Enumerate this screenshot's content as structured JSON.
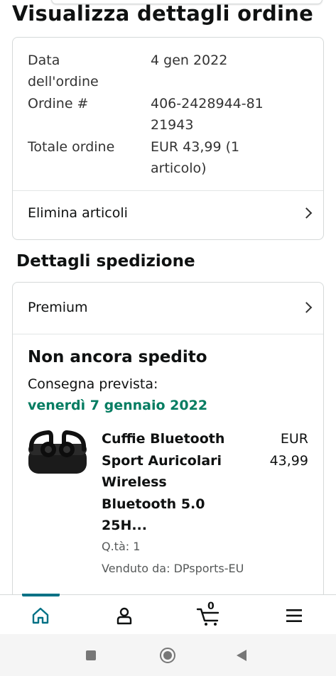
{
  "page": {
    "title": "Visualizza dettagli ordine"
  },
  "order": {
    "date_label": "Data dell'ordine",
    "date_value": "4 gen 2022",
    "number_label": "Ordine #",
    "number_value": "406-2428944-8121943",
    "total_label": "Totale ordine",
    "total_value": "EUR 43,99 (1 articolo)",
    "delete_link": "Elimina articoli"
  },
  "shipping": {
    "section_title": "Dettagli spedizione",
    "method": "Premium",
    "status": "Non ancora spedito",
    "delivery_label": "Consegna prevista:",
    "delivery_date": "venerdì 7 gennaio 2022",
    "item": {
      "title": "Cuffie Bluetooth Sport Auricolari Wireless Bluetooth 5.0 25H...",
      "price": "EUR 43,99",
      "quantity": "Q.tà: 1",
      "seller": "Venduto da: DPsports-EU",
      "image_icon": "earbuds-image"
    }
  },
  "tabbar": {
    "items": [
      {
        "icon": "home-icon",
        "active": true
      },
      {
        "icon": "account-icon",
        "active": false
      },
      {
        "icon": "cart-icon",
        "active": false,
        "badge": "0"
      },
      {
        "icon": "menu-icon",
        "active": false
      }
    ]
  },
  "colors": {
    "accent": "#007185",
    "delivery_green": "#067d62",
    "text": "#0f1111",
    "muted": "#565959",
    "border": "#d5d9d9"
  }
}
